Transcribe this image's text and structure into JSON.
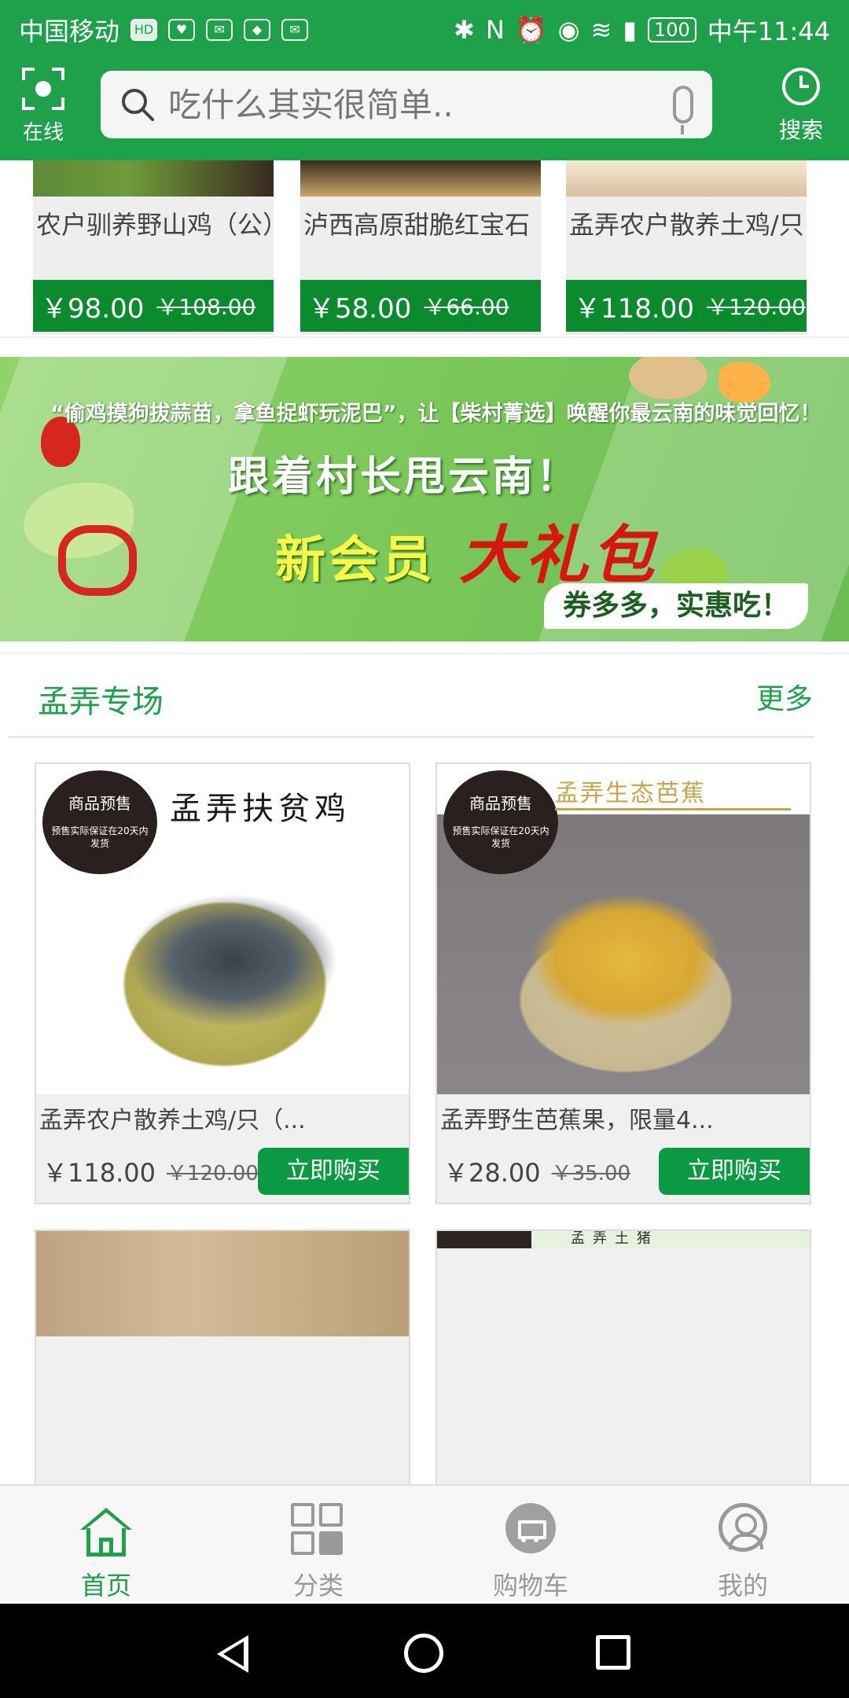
{
  "status_bar": {
    "carrier": "中国移动",
    "hd": "HD",
    "battery": "100",
    "time": "中午11:44"
  },
  "header": {
    "scan_label": "在线",
    "search_placeholder": "吃什么其实很简单..",
    "history_label": "搜索",
    "accent_color": "#1fa04a"
  },
  "top_products": [
    {
      "title": "农户驯养野山鸡（公）",
      "price": "￥98.00",
      "old_price": "￥108.00"
    },
    {
      "title": "泸西高原甜脆红宝石（",
      "price": "￥58.00",
      "old_price": "￥66.00"
    },
    {
      "title": "孟弄农户散养土鸡/只（",
      "price": "￥118.00",
      "old_price": "￥120.00"
    }
  ],
  "banner": {
    "quote": "“偷鸡摸狗拔蒜苗，拿鱼捉虾玩泥巴”，让【柴村菁选】唤醒你最云南的味觉回忆！",
    "headline": "跟着村长甩云南！",
    "sub_yellow": "新会员",
    "sub_red": "大礼包",
    "tag": "券多多，实惠吃！"
  },
  "section": {
    "title": "孟弄专场",
    "more": "更多"
  },
  "products": [
    {
      "title": "孟弄农户散养土鸡/只（...",
      "price": "￥118.00",
      "old_price": "￥120.00",
      "buy": "立即购买",
      "badge_title": "商品预售",
      "badge_note": "预售实际保证在20天内发货",
      "caption": "孟弄扶贫鸡"
    },
    {
      "title": "孟弄野生芭蕉果，限量4...",
      "price": "￥28.00",
      "old_price": "￥35.00",
      "buy": "立即购买",
      "badge_title": "商品预售",
      "badge_note": "预售实际保证在20天内发货",
      "caption": "孟弄生态芭蕉"
    }
  ],
  "partial_products": [
    {
      "caption": ""
    },
    {
      "caption": "孟弄土猪"
    }
  ],
  "bottom_nav": [
    {
      "label": "首页",
      "active": true
    },
    {
      "label": "分类",
      "active": false
    },
    {
      "label": "购物车",
      "active": false
    },
    {
      "label": "我的",
      "active": false
    }
  ]
}
